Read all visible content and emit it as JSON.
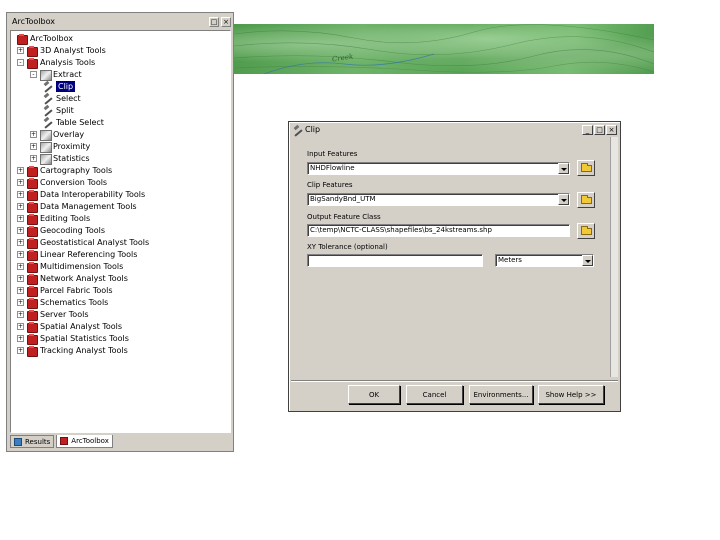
{
  "map": {
    "label": "Creek"
  },
  "toolbox": {
    "title": "ArcToolbox",
    "pin_symbol": "□",
    "close_symbol": "×",
    "items": [
      {
        "label": "ArcToolbox",
        "icon": "toolbox-icon",
        "level": 0,
        "expander": ""
      },
      {
        "label": "3D Analyst Tools",
        "icon": "toolbox-icon",
        "level": 0,
        "expander": "+"
      },
      {
        "label": "Analysis Tools",
        "icon": "toolbox-icon",
        "level": 0,
        "expander": "-"
      },
      {
        "label": "Extract",
        "icon": "toolset-icon",
        "level": 1,
        "expander": "-"
      },
      {
        "label": "Clip",
        "icon": "tool-hammer-icon",
        "level": 2,
        "expander": "",
        "selected": true
      },
      {
        "label": "Select",
        "icon": "tool-hammer-icon",
        "level": 2,
        "expander": ""
      },
      {
        "label": "Split",
        "icon": "tool-hammer-icon",
        "level": 2,
        "expander": ""
      },
      {
        "label": "Table Select",
        "icon": "tool-hammer-icon",
        "level": 2,
        "expander": ""
      },
      {
        "label": "Overlay",
        "icon": "toolset-icon",
        "level": 1,
        "expander": "+"
      },
      {
        "label": "Proximity",
        "icon": "toolset-icon",
        "level": 1,
        "expander": "+"
      },
      {
        "label": "Statistics",
        "icon": "toolset-icon",
        "level": 1,
        "expander": "+"
      },
      {
        "label": "Cartography Tools",
        "icon": "toolbox-icon",
        "level": 0,
        "expander": "+"
      },
      {
        "label": "Conversion Tools",
        "icon": "toolbox-icon",
        "level": 0,
        "expander": "+"
      },
      {
        "label": "Data Interoperability Tools",
        "icon": "toolbox-icon",
        "level": 0,
        "expander": "+"
      },
      {
        "label": "Data Management Tools",
        "icon": "toolbox-icon",
        "level": 0,
        "expander": "+"
      },
      {
        "label": "Editing Tools",
        "icon": "toolbox-icon",
        "level": 0,
        "expander": "+"
      },
      {
        "label": "Geocoding Tools",
        "icon": "toolbox-icon",
        "level": 0,
        "expander": "+"
      },
      {
        "label": "Geostatistical Analyst Tools",
        "icon": "toolbox-icon",
        "level": 0,
        "expander": "+"
      },
      {
        "label": "Linear Referencing Tools",
        "icon": "toolbox-icon",
        "level": 0,
        "expander": "+"
      },
      {
        "label": "Multidimension Tools",
        "icon": "toolbox-icon",
        "level": 0,
        "expander": "+"
      },
      {
        "label": "Network Analyst Tools",
        "icon": "toolbox-icon",
        "level": 0,
        "expander": "+"
      },
      {
        "label": "Parcel Fabric Tools",
        "icon": "toolbox-icon",
        "level": 0,
        "expander": "+"
      },
      {
        "label": "Schematics Tools",
        "icon": "toolbox-icon",
        "level": 0,
        "expander": "+"
      },
      {
        "label": "Server Tools",
        "icon": "toolbox-icon",
        "level": 0,
        "expander": "+"
      },
      {
        "label": "Spatial Analyst Tools",
        "icon": "toolbox-icon",
        "level": 0,
        "expander": "+"
      },
      {
        "label": "Spatial Statistics Tools",
        "icon": "toolbox-icon",
        "level": 0,
        "expander": "+"
      },
      {
        "label": "Tracking Analyst Tools",
        "icon": "toolbox-icon",
        "level": 0,
        "expander": "+"
      }
    ],
    "tabs": [
      {
        "label": "Results",
        "active": false
      },
      {
        "label": "ArcToolbox",
        "active": true
      }
    ]
  },
  "clip_dialog": {
    "title": "Clip",
    "minimize_symbol": "_",
    "maximize_symbol": "□",
    "close_symbol": "×",
    "input_features_label": "Input Features",
    "input_features_value": "NHDFlowline",
    "clip_features_label": "Clip Features",
    "clip_features_value": "BigSandyBnd_UTM",
    "output_label": "Output Feature Class",
    "output_value": "C:\\temp\\NCTC-CLASS\\shapefiles\\bs_24kstreams.shp",
    "tolerance_label": "XY Tolerance (optional)",
    "tolerance_value": "",
    "units_value": "Meters",
    "buttons": {
      "ok": "OK",
      "cancel": "Cancel",
      "environments": "Environments...",
      "show_help": "Show Help >>"
    }
  }
}
